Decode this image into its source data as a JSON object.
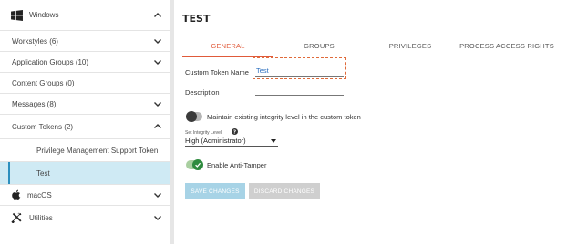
{
  "sidebar": {
    "windows": {
      "label": "Windows",
      "icon": "windows-logo-icon"
    },
    "items": [
      {
        "label": "Workstyles (6)",
        "expandable": true
      },
      {
        "label": "Application Groups (10)",
        "expandable": true
      },
      {
        "label": "Content Groups (0)",
        "expandable": false
      },
      {
        "label": "Messages (8)",
        "expandable": true
      },
      {
        "label": "Custom Tokens (2)",
        "expandable": true,
        "expanded": true
      },
      {
        "label": "Privilege Management Support Token",
        "expandable": false
      },
      {
        "label": "Test",
        "expandable": false,
        "selected": true
      }
    ],
    "macos": {
      "label": "macOS",
      "icon": "apple-logo-icon"
    },
    "utilities": {
      "label": "Utilities",
      "icon": "tools-icon"
    }
  },
  "main": {
    "title": "TEST",
    "tabs": [
      {
        "label": "GENERAL",
        "active": true
      },
      {
        "label": "GROUPS",
        "active": false
      },
      {
        "label": "PRIVILEGES",
        "active": false
      },
      {
        "label": "PROCESS ACCESS RIGHTS",
        "active": false
      }
    ],
    "form": {
      "name_label": "Custom Token Name",
      "name_value": "Test",
      "description_label": "Description",
      "description_value": "",
      "integrity_toggle_label": "Maintain existing integrity level in the custom token",
      "integrity_toggle_on": false,
      "integrity_level_label": "Set Integrity Level",
      "integrity_level_value": "High (Administrator)",
      "anti_tamper_label": "Enable Anti-Tamper",
      "anti_tamper_on": true
    },
    "buttons": {
      "save": "SAVE CHANGES",
      "discard": "DISCARD CHANGES"
    }
  },
  "colors": {
    "accent": "#e05a3a",
    "selected_bg": "#cfeaf4",
    "toggle_on": "#2e8b3e",
    "save_bg": "#a7d3e6",
    "discard_bg": "#cfcfcf",
    "link_text": "#2c6fbf"
  }
}
